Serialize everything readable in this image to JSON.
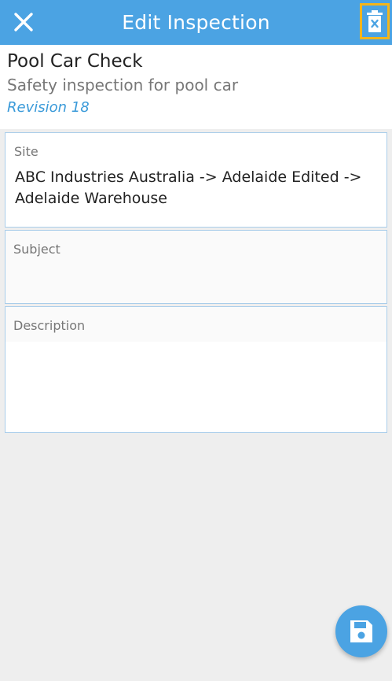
{
  "topbar": {
    "title": "Edit Inspection",
    "close_icon": "close-icon",
    "delete_icon": "trash-delete-icon"
  },
  "inspection": {
    "name": "Pool Car Check",
    "description": "Safety inspection for pool car",
    "revision": "Revision 18"
  },
  "fields": {
    "site": {
      "label": "Site",
      "value": "ABC Industries Australia -> Adelaide Edited -> Adelaide Warehouse"
    },
    "subject": {
      "label": "Subject",
      "value": ""
    },
    "description": {
      "label": "Description",
      "value": ""
    }
  },
  "fab": {
    "icon": "save-icon"
  },
  "colors": {
    "primary": "#4ba3e3",
    "highlight": "#f3b51b",
    "revision": "#3a9ad9",
    "background": "#eeeeee"
  }
}
